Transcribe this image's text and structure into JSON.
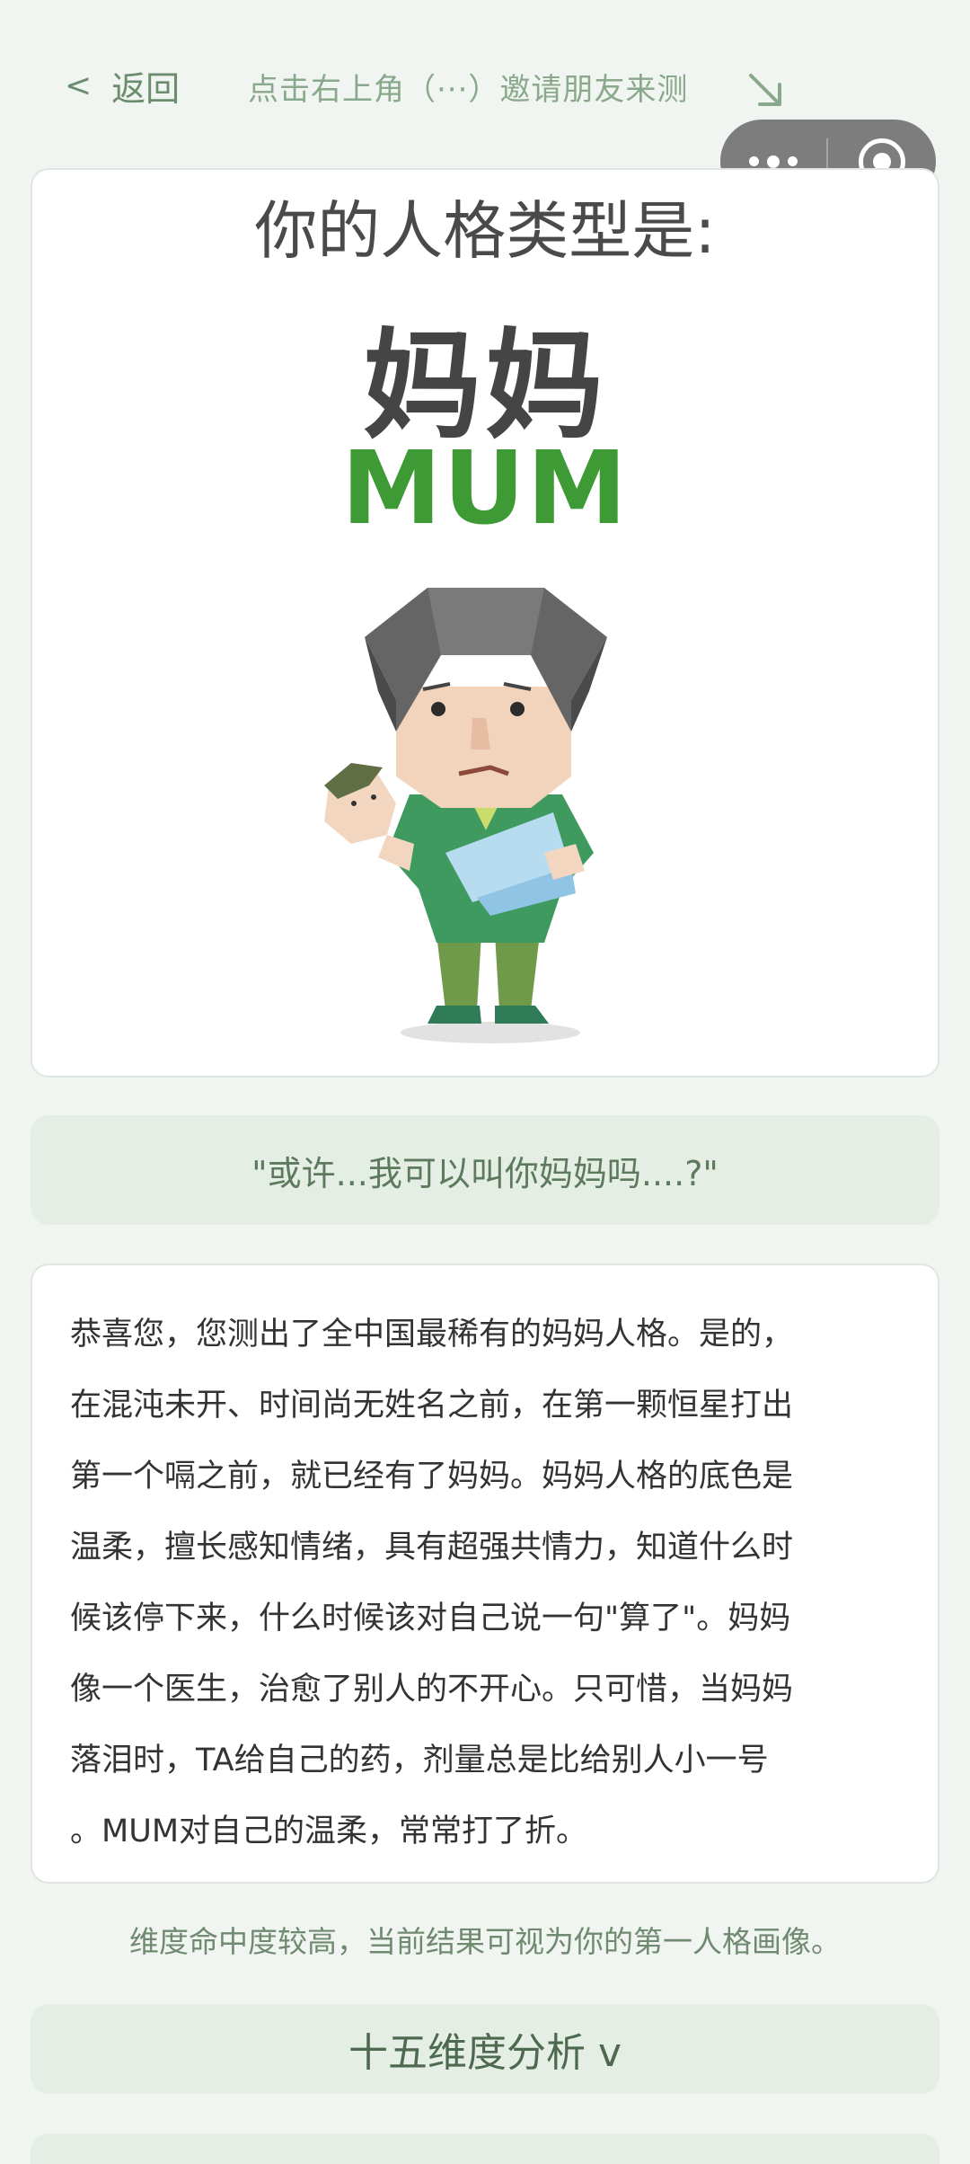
{
  "topbar": {
    "back_chevron": "<",
    "back_label": "返回",
    "share_hint": "点击右上角（···）邀请朋友来测"
  },
  "result": {
    "headline": "你的人格类型是:",
    "type_cn": "妈妈",
    "type_en": "MUM"
  },
  "quote": "\"或许...我可以叫你妈妈吗....?\"",
  "description": {
    "lines": [
      "恭喜您，您测出了全中国最稀有的妈妈人格。是的，",
      "在混沌未开、时间尚无姓名之前，在第一颗恒星打出",
      "第一个嗝之前，就已经有了妈妈。妈妈人格的底色是",
      "温柔，擅长感知情绪，具有超强共情力，知道什么时",
      "候该停下来，什么时候该对自己说一句\"算了\"。妈妈",
      "像一个医生，治愈了别人的不开心。只可惜，当妈妈",
      "落泪时，TA给自己的药，剂量总是比给别人小一号",
      "。MUM对自己的温柔，常常打了折。"
    ]
  },
  "note": "维度命中度较高，当前结果可视为你的第一人格画像。",
  "dimensions_button": "十五维度分析 v",
  "icons": {
    "arrow": "arrow-down-right-icon",
    "more": "more-dots-icon",
    "close": "mini-program-close-icon"
  },
  "colors": {
    "accent_green": "#3d9a34",
    "panel_green": "#e5eee4",
    "page_bg": "#f1f5f1"
  }
}
